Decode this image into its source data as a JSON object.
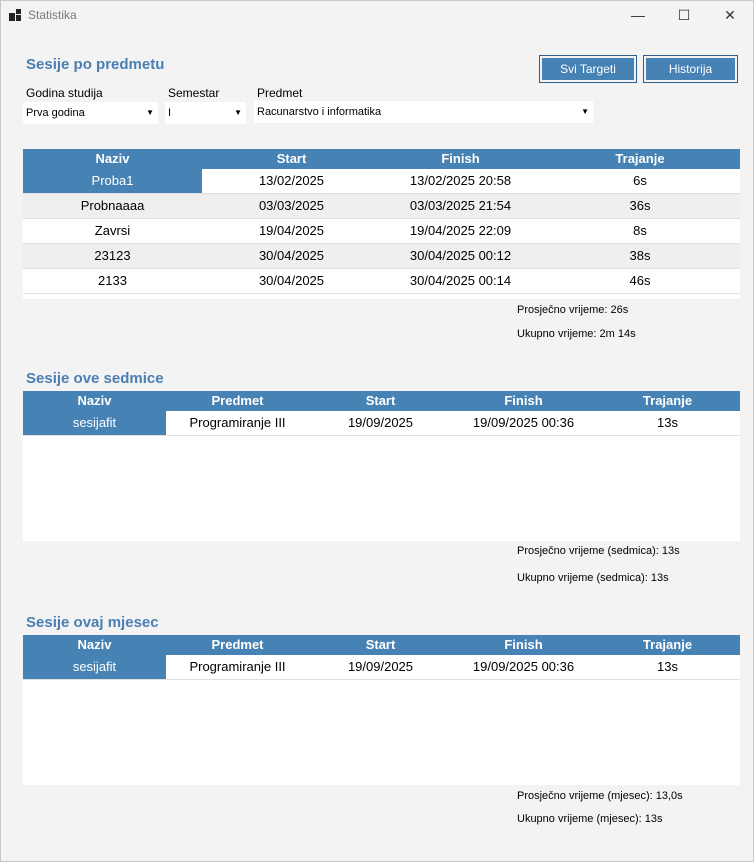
{
  "window": {
    "title": "Statistika",
    "minimize": "—",
    "maximize": "☐",
    "close": "✕"
  },
  "section1": {
    "title": "Sesije po predmetu",
    "buttons": {
      "targets": "Svi Targeti",
      "history": "Historija"
    },
    "filters": {
      "year_label": "Godina studija",
      "year_value": "Prva godina",
      "semester_label": "Semestar",
      "semester_value": "I",
      "subject_label": "Predmet",
      "subject_value": "Racunarstvo i informatika"
    },
    "columns": [
      "Naziv",
      "Start",
      "Finish",
      "Trajanje"
    ],
    "rows": [
      [
        "Proba1",
        "13/02/2025",
        "13/02/2025 20:58",
        "6s"
      ],
      [
        "Probnaaaa",
        "03/03/2025",
        "03/03/2025 21:54",
        "36s"
      ],
      [
        "Zavrsi",
        "19/04/2025",
        "19/04/2025 22:09",
        "8s"
      ],
      [
        "23123",
        "30/04/2025",
        "30/04/2025 00:12",
        "38s"
      ],
      [
        "2133",
        "30/04/2025",
        "30/04/2025 00:14",
        "46s"
      ]
    ],
    "avg": "Prosječno vrijeme: 26s",
    "total": "Ukupno vrijeme: 2m 14s"
  },
  "section2": {
    "title": "Sesije ove sedmice",
    "columns": [
      "Naziv",
      "Predmet",
      "Start",
      "Finish",
      "Trajanje"
    ],
    "rows": [
      [
        "sesijafit",
        "Programiranje III",
        "19/09/2025",
        "19/09/2025 00:36",
        "13s"
      ]
    ],
    "avg": "Prosječno vrijeme (sedmica): 13s",
    "total": "Ukupno vrijeme (sedmica): 13s"
  },
  "section3": {
    "title": "Sesije ovaj mjesec",
    "columns": [
      "Naziv",
      "Predmet",
      "Start",
      "Finish",
      "Trajanje"
    ],
    "rows": [
      [
        "sesijafit",
        "Programiranje III",
        "19/09/2025",
        "19/09/2025 00:36",
        "13s"
      ]
    ],
    "avg": "Prosječno vrijeme (mjesec): 13,0s",
    "total": "Ukupno vrijeme (mjesec): 13s"
  }
}
